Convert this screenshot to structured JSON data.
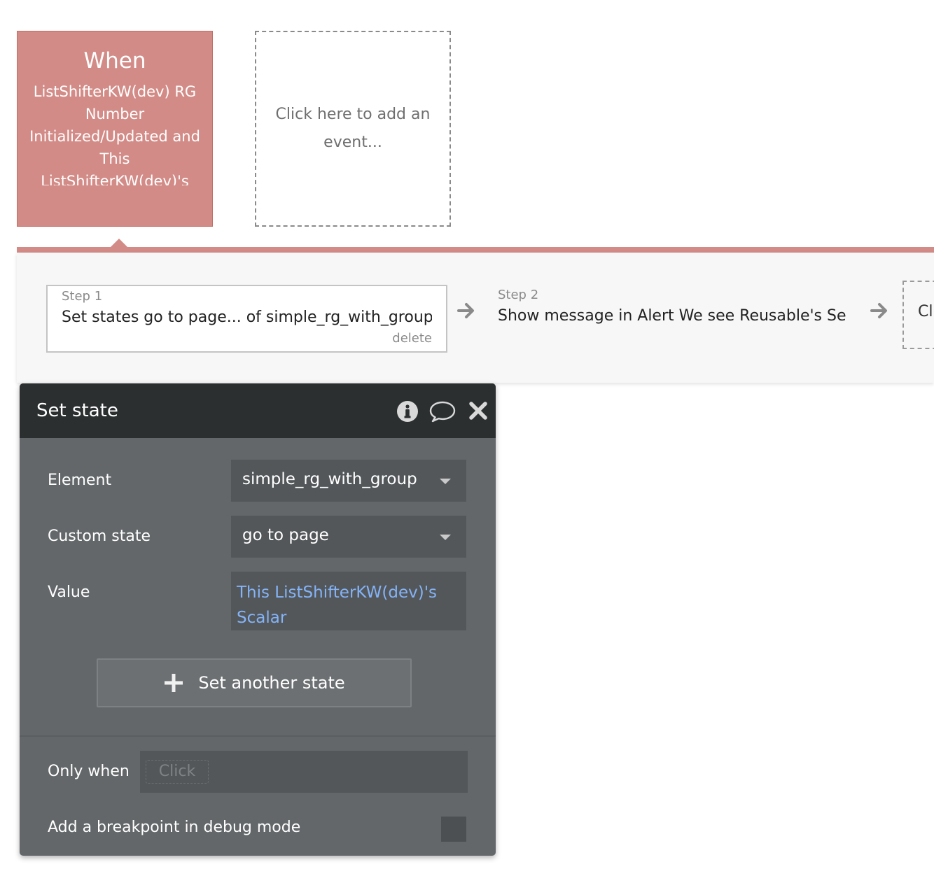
{
  "event": {
    "when_label": "When",
    "description": "ListShifterKW(dev) RG Number Initialized/Updated and This ListShifterKW(dev)'s Scalar is not empty"
  },
  "add_event": {
    "label": "Click here to add an event..."
  },
  "steps": [
    {
      "number": "Step 1",
      "title": "Set states go to page... of simple_rg_with_group",
      "delete_label": "delete"
    },
    {
      "number": "Step 2",
      "title": "Show message in Alert We see Reusable's Se"
    }
  ],
  "next_step_label": "Cl",
  "panel": {
    "title": "Set state",
    "element_label": "Element",
    "element_value": "simple_rg_with_group",
    "custom_state_label": "Custom state",
    "custom_state_value": "go to page",
    "value_label": "Value",
    "value_expression": "This ListShifterKW(dev)'s Scalar",
    "add_button_label": "Set another state",
    "only_when_label": "Only when",
    "only_when_placeholder": "Click",
    "breakpoint_label": "Add a breakpoint in debug mode"
  },
  "colors": {
    "event_bg": "#d28b86",
    "panel_bg": "#636769",
    "panel_header_bg": "#2b2f30",
    "expression_blue": "#84b3f7"
  }
}
